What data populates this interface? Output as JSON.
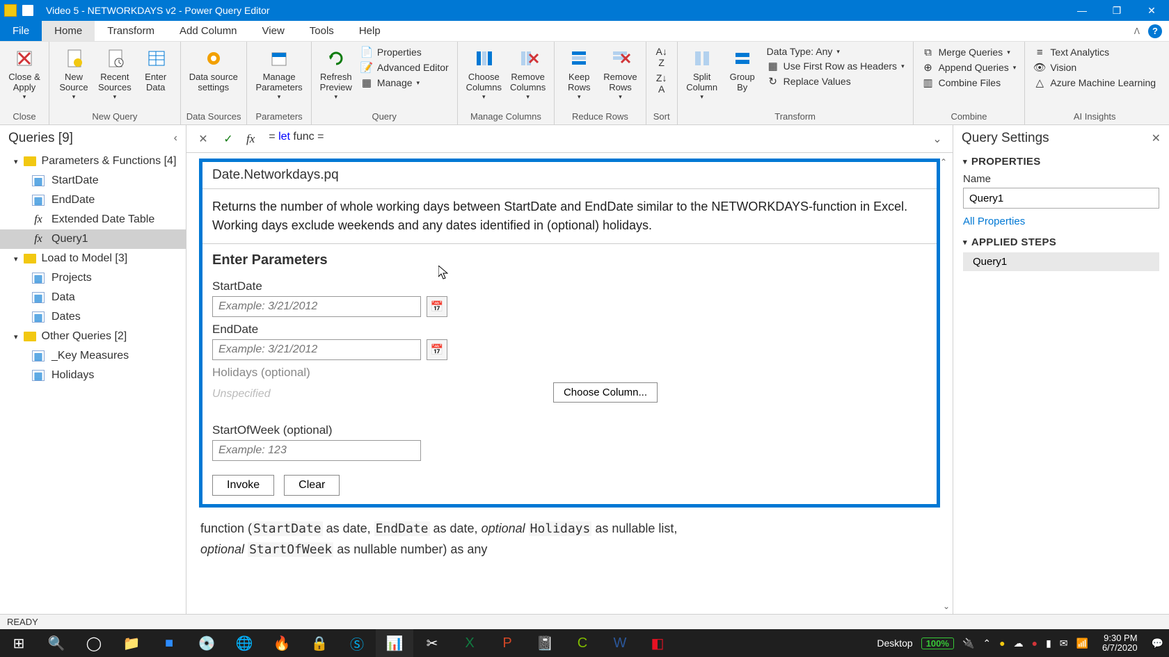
{
  "titlebar": {
    "title": "Video 5 - NETWORKDAYS v2 - Power Query Editor"
  },
  "menu": {
    "file": "File",
    "home": "Home",
    "transform": "Transform",
    "addcol": "Add Column",
    "view": "View",
    "tools": "Tools",
    "help": "Help"
  },
  "ribbon": {
    "close": {
      "label": "Close &\nApply",
      "group": "Close"
    },
    "newq": {
      "new": "New\nSource",
      "recent": "Recent\nSources",
      "enter": "Enter\nData",
      "group": "New Query"
    },
    "datasources": {
      "settings": "Data source\nsettings",
      "group": "Data Sources"
    },
    "params": {
      "manage": "Manage\nParameters",
      "group": "Parameters"
    },
    "query": {
      "refresh": "Refresh\nPreview",
      "properties": "Properties",
      "adv": "Advanced Editor",
      "manage": "Manage",
      "group": "Query"
    },
    "managecols": {
      "choose": "Choose\nColumns",
      "remove": "Remove\nColumns",
      "group": "Manage Columns"
    },
    "reducerows": {
      "keep": "Keep\nRows",
      "remove": "Remove\nRows",
      "group": "Reduce Rows"
    },
    "sort": {
      "group": "Sort"
    },
    "transform": {
      "split": "Split\nColumn",
      "group": "Group\nBy",
      "datatype": "Data Type: Any",
      "firstrow": "Use First Row as Headers",
      "replace": "Replace Values",
      "glabel": "Transform"
    },
    "combine": {
      "merge": "Merge Queries",
      "append": "Append Queries",
      "files": "Combine Files",
      "group": "Combine"
    },
    "ai": {
      "text": "Text Analytics",
      "vision": "Vision",
      "azure": "Azure Machine Learning",
      "group": "AI Insights"
    }
  },
  "queries": {
    "title": "Queries [9]",
    "folders": [
      {
        "name": "Parameters & Functions [4]",
        "items": [
          {
            "label": "StartDate",
            "icon": "table"
          },
          {
            "label": "EndDate",
            "icon": "table"
          },
          {
            "label": "Extended Date Table",
            "icon": "fx"
          },
          {
            "label": "Query1",
            "icon": "fx",
            "selected": true
          }
        ]
      },
      {
        "name": "Load to Model [3]",
        "items": [
          {
            "label": "Projects",
            "icon": "table"
          },
          {
            "label": "Data",
            "icon": "table"
          },
          {
            "label": "Dates",
            "icon": "table"
          }
        ]
      },
      {
        "name": "Other Queries [2]",
        "items": [
          {
            "label": "_Key Measures",
            "icon": "table"
          },
          {
            "label": "Holidays",
            "icon": "table"
          }
        ]
      }
    ]
  },
  "formula": {
    "prefix": "= ",
    "let": "let",
    "rest": " func ="
  },
  "func": {
    "title": "Date.Networkdays.pq",
    "desc": "Returns the number of whole working days between StartDate and EndDate similar to the NETWORKDAYS-function in Excel. Working days exclude weekends and any dates identified in (optional) holidays.",
    "enter": "Enter Parameters",
    "p1": {
      "label": "StartDate",
      "ph": "Example: 3/21/2012"
    },
    "p2": {
      "label": "EndDate",
      "ph": "Example: 3/21/2012"
    },
    "p3": {
      "label": "Holidays (optional)",
      "val": "Unspecified",
      "choose": "Choose Column..."
    },
    "p4": {
      "label": "StartOfWeek (optional)",
      "ph": "Example: 123"
    },
    "invoke": "Invoke",
    "clear": "Clear",
    "sig_parts": {
      "func": "function (",
      "sd": "StartDate",
      "asdate": " as date, ",
      "ed": "EndDate",
      "asdate2": " as date, ",
      "opt": "optional ",
      "hol": "Holidays",
      "asnlist": " as nullable list,",
      "sow": "StartOfWeek",
      "asnnum": " as nullable number) as any"
    }
  },
  "settings": {
    "title": "Query Settings",
    "properties": "PROPERTIES",
    "name_label": "Name",
    "name_value": "Query1",
    "all_props": "All Properties",
    "applied": "APPLIED STEPS",
    "steps": [
      "Query1"
    ]
  },
  "status": {
    "ready": "READY"
  },
  "taskbar": {
    "desktop": "Desktop",
    "battery": "100%",
    "time": "9:30 PM",
    "date": "6/7/2020"
  }
}
